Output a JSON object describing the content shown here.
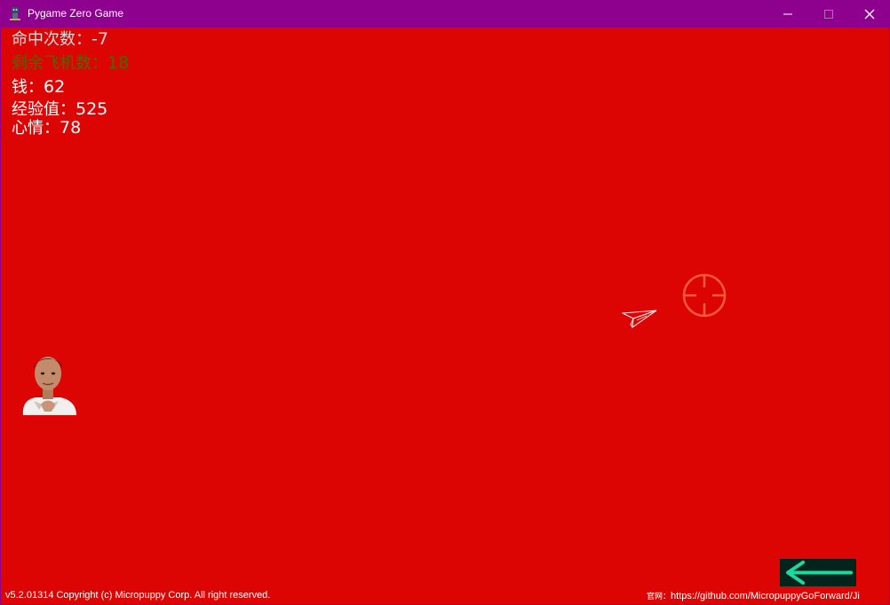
{
  "window": {
    "title": "Pygame Zero Game",
    "buttons": {
      "minimize_icon": "minimize-icon",
      "maximize_icon": "maximize-icon",
      "close_icon": "close-icon"
    },
    "colors": {
      "titlebar": "#8e008e"
    }
  },
  "game": {
    "background": "#dd0504",
    "stats": {
      "hits": {
        "label": "命中次数：",
        "value": "-7",
        "color": "#d9d9d9"
      },
      "planes_left": {
        "label": "剩余飞机数：",
        "value": "18",
        "color": "#3d7000"
      },
      "money": {
        "label": "钱：",
        "value": "62",
        "color": "#ffffff"
      },
      "experience": {
        "label": "经验值：",
        "value": "525",
        "color": "#ffffff"
      },
      "mood": {
        "label": "心情：",
        "value": "78",
        "color": "#ffffff"
      }
    },
    "sprites": {
      "crosshair": "crosshair-icon",
      "plane": "paper-plane-icon",
      "player": "player-avatar"
    },
    "back_button": {
      "icon": "arrow-left-icon",
      "color": "#1fd7a0"
    }
  },
  "footer": {
    "copyright": "v5.2.01314 Copyright (c) Micropuppy Corp. All right reserved.",
    "site_label": "官网：",
    "site_url": "https://github.com/MicropuppyGoForward/Ji"
  }
}
